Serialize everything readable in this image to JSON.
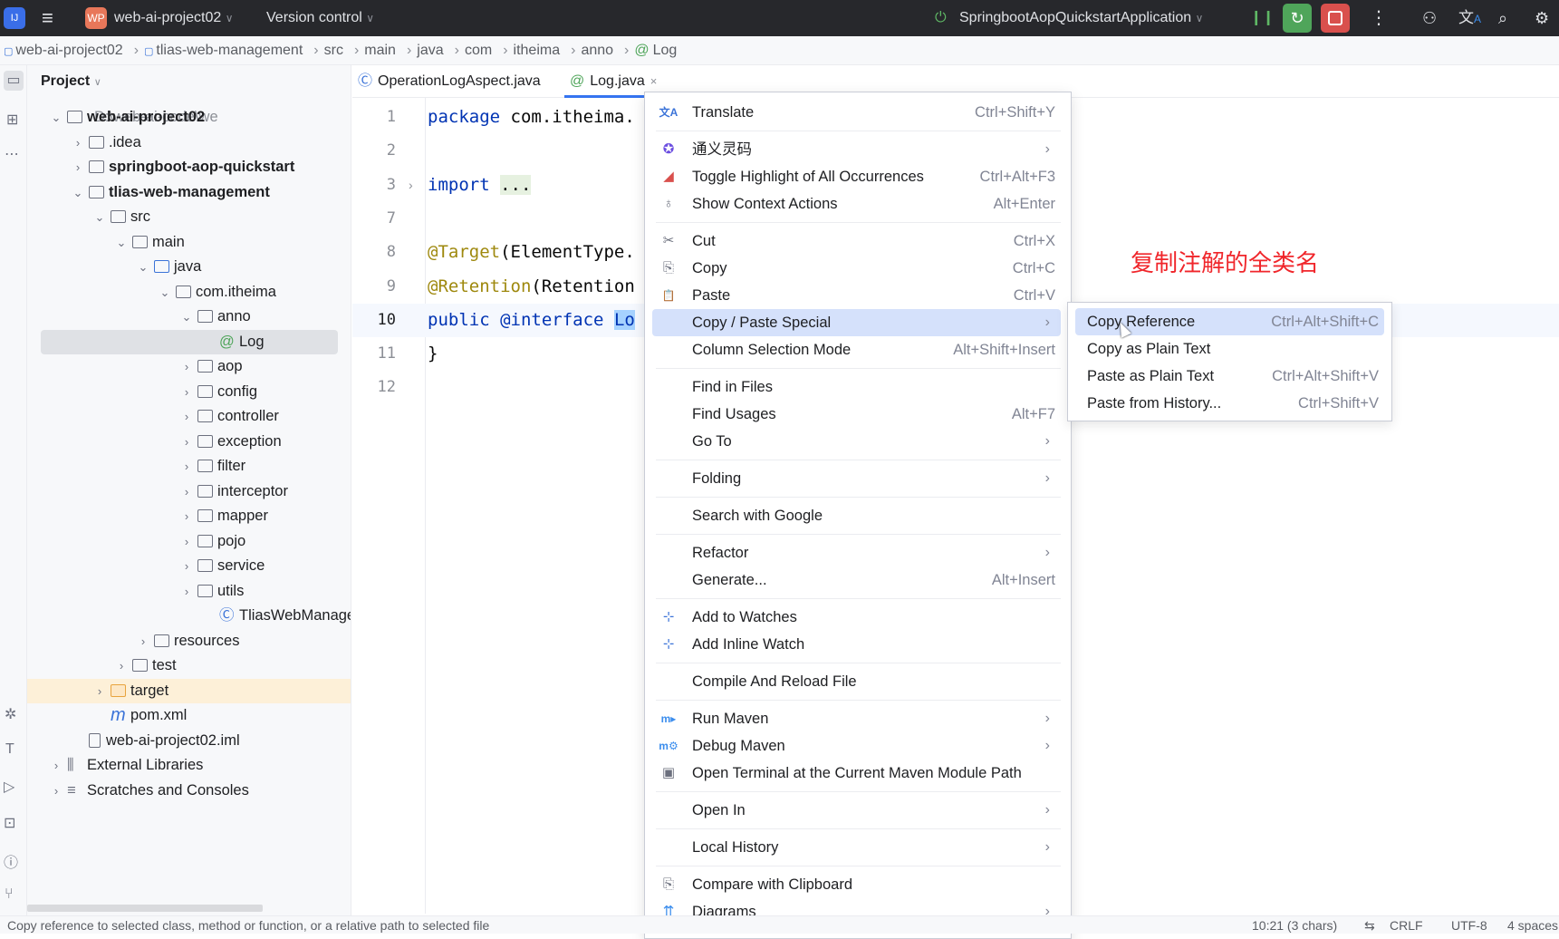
{
  "titlebar": {
    "project_badge": "WP",
    "project_name": "web-ai-project02",
    "vcs": "Version control",
    "run_config": "SpringbootAopQuickstartApplication",
    "colors": {
      "bg": "#27282c",
      "project_badge": "#e8775a",
      "debug": "#4fa55a",
      "stop": "#d9504d"
    }
  },
  "breadcrumb": [
    "web-ai-project02",
    "tlias-web-management",
    "src",
    "main",
    "java",
    "com",
    "itheima",
    "anno",
    "Log"
  ],
  "project_panel": {
    "title": "Project",
    "tree": [
      {
        "level": 0,
        "label": "web-ai-project02",
        "hint": "D:\\web-ai-code\\we",
        "bold": true,
        "chevron": "down",
        "icon": "module-folder-icon"
      },
      {
        "level": 1,
        "label": ".idea",
        "chevron": "right",
        "icon": "folder-icon"
      },
      {
        "level": 1,
        "label": "springboot-aop-quickstart",
        "bold": true,
        "chevron": "right",
        "icon": "module-folder-icon"
      },
      {
        "level": 1,
        "label": "tlias-web-management",
        "bold": true,
        "chevron": "down",
        "icon": "module-folder-icon"
      },
      {
        "level": 2,
        "label": "src",
        "chevron": "down",
        "icon": "folder-icon"
      },
      {
        "level": 3,
        "label": "main",
        "chevron": "down",
        "icon": "folder-icon"
      },
      {
        "level": 4,
        "label": "java",
        "chevron": "down",
        "icon": "source-folder-icon"
      },
      {
        "level": 5,
        "label": "com.itheima",
        "chevron": "down",
        "icon": "package-icon"
      },
      {
        "level": 6,
        "label": "anno",
        "chevron": "down",
        "icon": "package-icon"
      },
      {
        "level": 7,
        "label": "Log",
        "icon": "annotation-icon",
        "selected": true
      },
      {
        "level": 6,
        "label": "aop",
        "chevron": "right",
        "icon": "package-icon"
      },
      {
        "level": 6,
        "label": "config",
        "chevron": "right",
        "icon": "package-icon"
      },
      {
        "level": 6,
        "label": "controller",
        "chevron": "right",
        "icon": "package-icon"
      },
      {
        "level": 6,
        "label": "exception",
        "chevron": "right",
        "icon": "package-icon"
      },
      {
        "level": 6,
        "label": "filter",
        "chevron": "right",
        "icon": "package-icon"
      },
      {
        "level": 6,
        "label": "interceptor",
        "chevron": "right",
        "icon": "package-icon"
      },
      {
        "level": 6,
        "label": "mapper",
        "chevron": "right",
        "icon": "package-icon"
      },
      {
        "level": 6,
        "label": "pojo",
        "chevron": "right",
        "icon": "package-icon"
      },
      {
        "level": 6,
        "label": "service",
        "chevron": "right",
        "icon": "package-icon"
      },
      {
        "level": 6,
        "label": "utils",
        "chevron": "right",
        "icon": "package-icon"
      },
      {
        "level": 7,
        "label": "TliasWebManageme",
        "icon": "spring-boot-class-icon"
      },
      {
        "level": 4,
        "label": "resources",
        "chevron": "right",
        "icon": "resources-folder-icon"
      },
      {
        "level": 3,
        "label": "test",
        "chevron": "right",
        "icon": "folder-icon"
      },
      {
        "level": 2,
        "label": "target",
        "chevron": "right",
        "icon": "excluded-folder-icon",
        "highlight": true
      },
      {
        "level": 2,
        "label": "pom.xml",
        "icon": "maven-icon"
      },
      {
        "level": 1,
        "label": "web-ai-project02.iml",
        "icon": "iml-file-icon"
      },
      {
        "level": 0,
        "label": "External Libraries",
        "chevron": "right",
        "icon": "library-icon"
      },
      {
        "level": 0,
        "label": "Scratches and Consoles",
        "chevron": "right",
        "icon": "scratches-icon"
      }
    ]
  },
  "editor": {
    "tabs": [
      {
        "label": "OperationLogAspect.java",
        "icon": "class-icon",
        "active": false
      },
      {
        "label": "Log.java",
        "icon": "annotation-icon",
        "active": true
      }
    ],
    "lines": [
      {
        "n": "1",
        "tokens": [
          {
            "t": "package",
            "c": "kw"
          },
          {
            "t": " com.itheima.",
            "c": "df"
          }
        ]
      },
      {
        "n": "2",
        "tokens": []
      },
      {
        "n": "3",
        "fold": true,
        "tokens": [
          {
            "t": "import",
            "c": "kw"
          },
          {
            "t": " ",
            "c": "df"
          },
          {
            "t": "...",
            "c": "fold"
          }
        ]
      },
      {
        "n": "7",
        "tokens": []
      },
      {
        "n": "8",
        "tokens": [
          {
            "t": "@Target",
            "c": "an"
          },
          {
            "t": "(ElementType.",
            "c": "df"
          }
        ]
      },
      {
        "n": "9",
        "tokens": [
          {
            "t": "@Retention",
            "c": "an"
          },
          {
            "t": "(Retention",
            "c": "df"
          }
        ]
      },
      {
        "n": "10",
        "current": true,
        "tokens": [
          {
            "t": "public",
            "c": "kw"
          },
          {
            "t": " ",
            "c": "df"
          },
          {
            "t": "@interface",
            "c": "kw"
          },
          {
            "t": " ",
            "c": "df"
          },
          {
            "t": "Lo",
            "c": "sel"
          }
        ]
      },
      {
        "n": "11",
        "tokens": [
          {
            "t": "}",
            "c": "df"
          }
        ]
      },
      {
        "n": "12",
        "tokens": []
      }
    ]
  },
  "context_menu": {
    "items": [
      {
        "label": "Translate",
        "shortcut": "Ctrl+Shift+Y",
        "icon": "translate-icon"
      },
      {
        "sep": true
      },
      {
        "label": "通义灵码",
        "submenu": true,
        "icon": "tongyi-lingma-icon"
      },
      {
        "label": "Toggle Highlight of All Occurrences",
        "shortcut": "Ctrl+Alt+F3",
        "icon": "highlight-icon"
      },
      {
        "label": "Show Context Actions",
        "shortcut": "Alt+Enter",
        "icon": "lightbulb-icon"
      },
      {
        "sep": true
      },
      {
        "label": "Cut",
        "shortcut": "Ctrl+X",
        "icon": "scissors-icon"
      },
      {
        "label": "Copy",
        "shortcut": "Ctrl+C",
        "icon": "copy-icon"
      },
      {
        "label": "Paste",
        "shortcut": "Ctrl+V",
        "icon": "paste-icon"
      },
      {
        "label": "Copy / Paste Special",
        "submenu": true,
        "highlighted": true
      },
      {
        "label": "Column Selection Mode",
        "shortcut": "Alt+Shift+Insert"
      },
      {
        "sep": true
      },
      {
        "label": "Find in Files"
      },
      {
        "label": "Find Usages",
        "shortcut": "Alt+F7"
      },
      {
        "label": "Go To",
        "submenu": true
      },
      {
        "sep": true
      },
      {
        "label": "Folding",
        "submenu": true
      },
      {
        "sep": true
      },
      {
        "label": "Search with Google"
      },
      {
        "sep": true
      },
      {
        "label": "Refactor",
        "submenu": true
      },
      {
        "label": "Generate...",
        "shortcut": "Alt+Insert"
      },
      {
        "sep": true
      },
      {
        "label": "Add to Watches",
        "icon": "watch-icon"
      },
      {
        "label": "Add Inline Watch",
        "icon": "watch-icon"
      },
      {
        "sep": true
      },
      {
        "label": "Compile And Reload File"
      },
      {
        "sep": true
      },
      {
        "label": "Run Maven",
        "submenu": true,
        "icon": "maven-run-icon"
      },
      {
        "label": "Debug Maven",
        "submenu": true,
        "icon": "maven-debug-icon"
      },
      {
        "label": "Open Terminal at the Current Maven Module Path",
        "icon": "terminal-maven-icon"
      },
      {
        "sep": true
      },
      {
        "label": "Open In",
        "submenu": true
      },
      {
        "sep": true
      },
      {
        "label": "Local History",
        "submenu": true
      },
      {
        "sep": true
      },
      {
        "label": "Compare with Clipboard",
        "icon": "compare-clipboard-icon"
      },
      {
        "label": "Diagrams",
        "submenu": true,
        "icon": "diagrams-icon"
      }
    ]
  },
  "submenu": {
    "items": [
      {
        "label": "Copy Reference",
        "shortcut": "Ctrl+Alt+Shift+C",
        "highlighted": true
      },
      {
        "label": "Copy as Plain Text"
      },
      {
        "label": "Paste as Plain Text",
        "shortcut": "Ctrl+Alt+Shift+V"
      },
      {
        "label": "Paste from History...",
        "shortcut": "Ctrl+Shift+V"
      }
    ]
  },
  "annotation": {
    "text": "复制注解的全类名",
    "color": "#f0262b"
  },
  "statusbar": {
    "message": "Copy reference to selected class, method or function, or a relative path to selected file",
    "position": "10:21 (3 chars)",
    "line_ending": "CRLF",
    "encoding": "UTF-8",
    "indent": "4 spaces"
  }
}
